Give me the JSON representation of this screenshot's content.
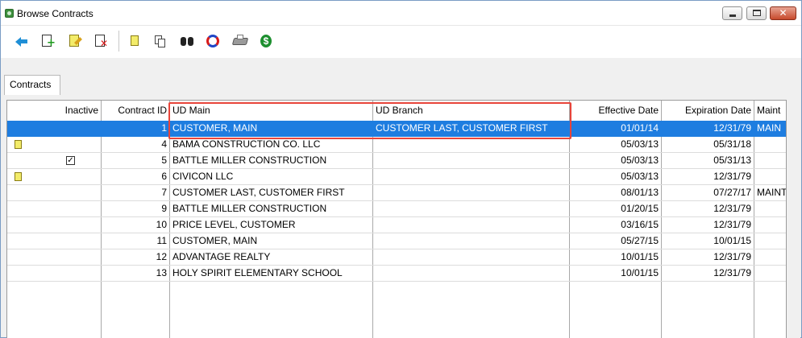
{
  "window": {
    "title": "Browse Contracts"
  },
  "toolbar": {
    "buttons": [
      {
        "name": "back-button",
        "icon": "arrow-left-icon"
      },
      {
        "name": "add-button",
        "icon": "add-document-icon"
      },
      {
        "name": "edit-button",
        "icon": "edit-document-icon"
      },
      {
        "name": "delete-button",
        "icon": "delete-document-icon"
      },
      {
        "name": "notes-button",
        "icon": "note-icon"
      },
      {
        "name": "copy-button",
        "icon": "copy-icon"
      },
      {
        "name": "find-button",
        "icon": "binoculars-icon"
      },
      {
        "name": "refresh-button",
        "icon": "refresh-icon"
      },
      {
        "name": "print-button",
        "icon": "printer-icon"
      },
      {
        "name": "pricing-button",
        "icon": "money-icon"
      }
    ]
  },
  "tabs": [
    {
      "label": "Contracts",
      "active": true
    }
  ],
  "grid": {
    "columns": [
      "Inactive",
      "Contract ID",
      "UD Main",
      "UD Branch",
      "Effective Date",
      "Expiration Date",
      "Maint"
    ],
    "rows": [
      {
        "note": false,
        "inactive": false,
        "contract_id": "1",
        "ud_main": "CUSTOMER, MAIN",
        "ud_branch": "CUSTOMER LAST, CUSTOMER FIRST",
        "effective": "01/01/14",
        "expiration": "12/31/79",
        "maint": "MAIN",
        "selected": true
      },
      {
        "note": true,
        "inactive": false,
        "contract_id": "4",
        "ud_main": "BAMA CONSTRUCTION CO. LLC",
        "ud_branch": "",
        "effective": "05/03/13",
        "expiration": "05/31/18",
        "maint": ""
      },
      {
        "note": false,
        "inactive": true,
        "contract_id": "5",
        "ud_main": "BATTLE MILLER CONSTRUCTION",
        "ud_branch": "",
        "effective": "05/03/13",
        "expiration": "05/31/13",
        "maint": ""
      },
      {
        "note": true,
        "inactive": false,
        "contract_id": "6",
        "ud_main": "CIVICON LLC",
        "ud_branch": "",
        "effective": "05/03/13",
        "expiration": "12/31/79",
        "maint": ""
      },
      {
        "note": false,
        "inactive": false,
        "contract_id": "7",
        "ud_main": "CUSTOMER LAST, CUSTOMER FIRST",
        "ud_branch": "",
        "effective": "08/01/13",
        "expiration": "07/27/17",
        "maint": "MAINT"
      },
      {
        "note": false,
        "inactive": false,
        "contract_id": "9",
        "ud_main": "BATTLE MILLER CONSTRUCTION",
        "ud_branch": "",
        "effective": "01/20/15",
        "expiration": "12/31/79",
        "maint": ""
      },
      {
        "note": false,
        "inactive": false,
        "contract_id": "10",
        "ud_main": "PRICE LEVEL, CUSTOMER",
        "ud_branch": "",
        "effective": "03/16/15",
        "expiration": "12/31/79",
        "maint": ""
      },
      {
        "note": false,
        "inactive": false,
        "contract_id": "11",
        "ud_main": "CUSTOMER, MAIN",
        "ud_branch": "",
        "effective": "05/27/15",
        "expiration": "10/01/15",
        "maint": ""
      },
      {
        "note": false,
        "inactive": false,
        "contract_id": "12",
        "ud_main": "ADVANTAGE REALTY",
        "ud_branch": "",
        "effective": "10/01/15",
        "expiration": "12/31/79",
        "maint": ""
      },
      {
        "note": false,
        "inactive": false,
        "contract_id": "13",
        "ud_main": "HOLY SPIRIT ELEMENTARY SCHOOL",
        "ud_branch": "",
        "effective": "10/01/15",
        "expiration": "12/31/79",
        "maint": ""
      }
    ]
  },
  "colors": {
    "selection": "#1e7de0",
    "annotation": "#e8443a",
    "note": "#f3ec6a"
  }
}
